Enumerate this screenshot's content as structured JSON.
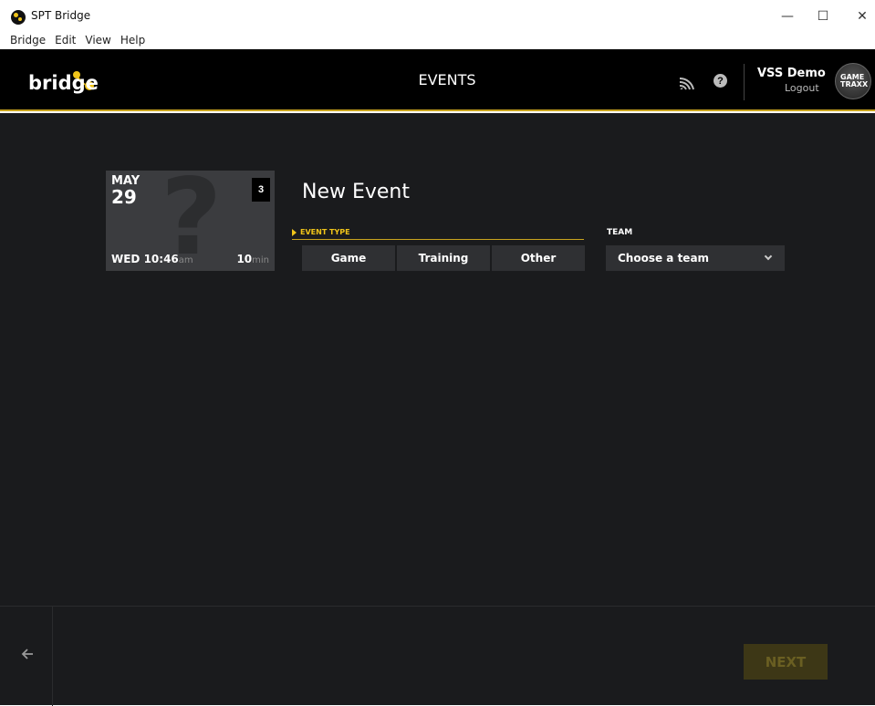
{
  "window": {
    "title": "SPT Bridge",
    "minimize": "—",
    "maximize": "☐",
    "close": "✕"
  },
  "menu": [
    "Bridge",
    "Edit",
    "View",
    "Help"
  ],
  "header": {
    "logo_text": "bridge",
    "heading": "EVENTS",
    "user_name": "VSS Demo",
    "logout_label": "Logout",
    "brand_line1": "GAME",
    "brand_line2": "TRAXX"
  },
  "card": {
    "month": "MAY",
    "day": "29",
    "count": "3",
    "weekday_time": "WED 10:46",
    "ampm": "am",
    "duration_value": "10",
    "duration_unit": "min"
  },
  "form": {
    "title": "New Event",
    "event_type_label": "EVENT TYPE",
    "event_types": [
      "Game",
      "Training",
      "Other"
    ],
    "team_label": "TEAM",
    "team_placeholder": "Choose a team"
  },
  "footer": {
    "next_label": "NEXT"
  },
  "colors": {
    "accent": "#f0c419",
    "background": "#1a1b1d",
    "header": "#000000"
  }
}
